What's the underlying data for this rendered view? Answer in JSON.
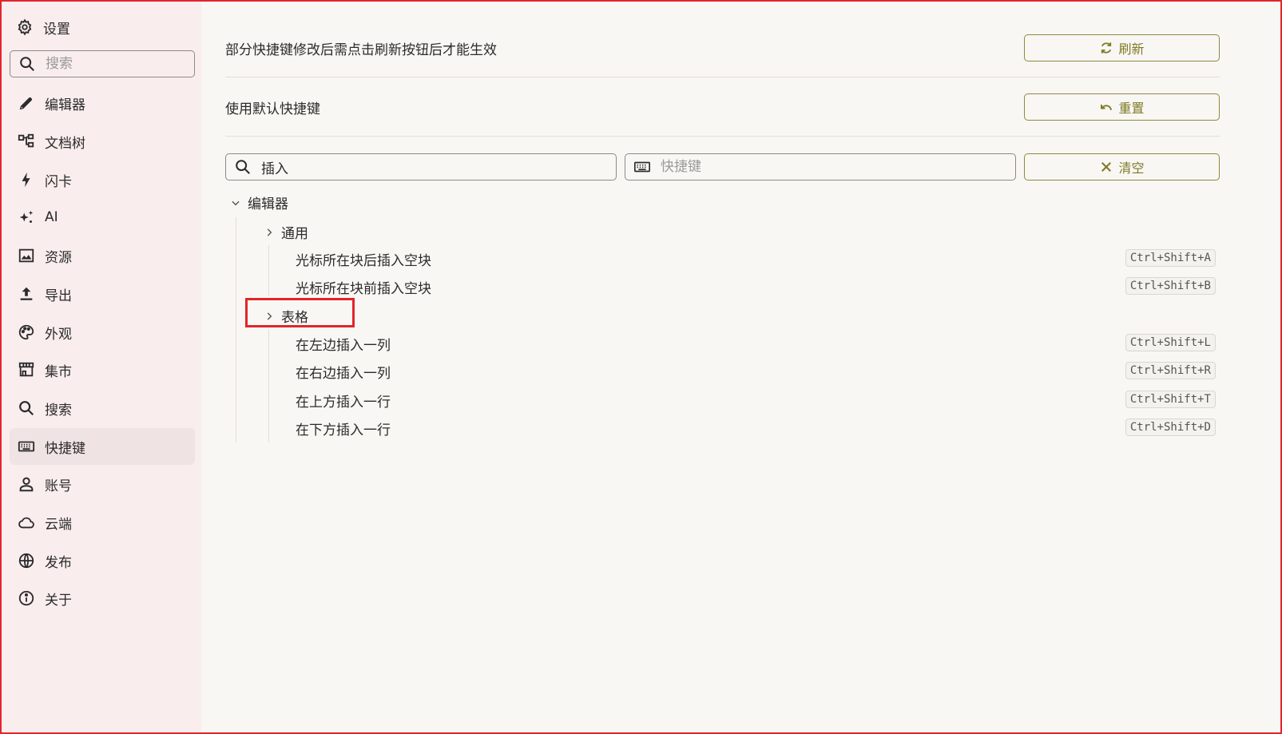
{
  "sidebar": {
    "title": "设置",
    "search_placeholder": "搜索",
    "items": [
      {
        "label": "编辑器",
        "icon": "pencil-icon"
      },
      {
        "label": "文档树",
        "icon": "tree-icon"
      },
      {
        "label": "闪卡",
        "icon": "lightning-icon"
      },
      {
        "label": "AI",
        "icon": "sparkle-icon"
      },
      {
        "label": "资源",
        "icon": "image-icon"
      },
      {
        "label": "导出",
        "icon": "upload-icon"
      },
      {
        "label": "外观",
        "icon": "palette-icon"
      },
      {
        "label": "集市",
        "icon": "store-icon"
      },
      {
        "label": "搜索",
        "icon": "search-icon"
      },
      {
        "label": "快捷键",
        "icon": "keyboard-icon",
        "active": true
      },
      {
        "label": "账号",
        "icon": "user-icon"
      },
      {
        "label": "云端",
        "icon": "cloud-icon"
      },
      {
        "label": "发布",
        "icon": "globe-icon"
      },
      {
        "label": "关于",
        "icon": "info-icon"
      }
    ]
  },
  "main": {
    "refresh_text": "部分快捷键修改后需点击刷新按钮后才能生效",
    "refresh_button": "刷新",
    "reset_text": "使用默认快捷键",
    "reset_button": "重置",
    "search_value": "插入",
    "keys_placeholder": "快捷键",
    "clear_button": "清空",
    "tree": {
      "root": "编辑器",
      "groups": [
        {
          "label": "通用",
          "items": [
            {
              "label": "光标所在块后插入空块",
              "keys": "Ctrl+Shift+A"
            },
            {
              "label": "光标所在块前插入空块",
              "keys": "Ctrl+Shift+B"
            }
          ]
        },
        {
          "label": "表格",
          "items": [
            {
              "label": "在左边插入一列",
              "keys": "Ctrl+Shift+L"
            },
            {
              "label": "在右边插入一列",
              "keys": "Ctrl+Shift+R"
            },
            {
              "label": "在上方插入一行",
              "keys": "Ctrl+Shift+T"
            },
            {
              "label": "在下方插入一行",
              "keys": "Ctrl+Shift+D"
            }
          ]
        }
      ]
    }
  },
  "colors": {
    "accent": "#7e7a24",
    "sidebar_bg": "#faeded",
    "highlight": "#e0262b"
  }
}
